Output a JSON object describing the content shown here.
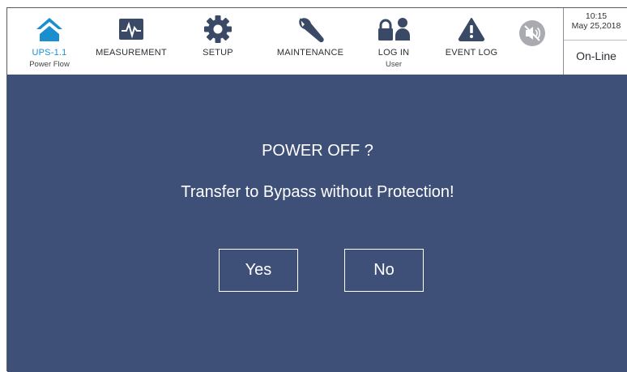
{
  "nav": {
    "items": [
      {
        "label": "UPS-1.1",
        "sub": "Power Flow",
        "icon": "home-icon",
        "active": true
      },
      {
        "label": "MEASUREMENT",
        "sub": "",
        "icon": "pulse-monitor-icon"
      },
      {
        "label": "SETUP",
        "sub": "",
        "icon": "gear-icon"
      },
      {
        "label": "MAINTENANCE",
        "sub": "",
        "icon": "wrench-icon"
      },
      {
        "label": "LOG IN",
        "sub": "User",
        "icon": "lock-user-icon"
      },
      {
        "label": "EVENT LOG",
        "sub": "",
        "icon": "warning-icon"
      }
    ],
    "mute_icon": "speaker-muted-icon"
  },
  "status": {
    "time": "10:15",
    "date": "May 25,2018",
    "mode": "On-Line"
  },
  "dialog": {
    "title": "POWER OFF ?",
    "message": "Transfer to Bypass without Protection!",
    "yes_label": "Yes",
    "no_label": "No"
  },
  "colors": {
    "accent": "#1a8fd0",
    "panel": "#3f5078",
    "icon_dark": "#3a4a66",
    "icon_muted": "#a9abb0"
  }
}
